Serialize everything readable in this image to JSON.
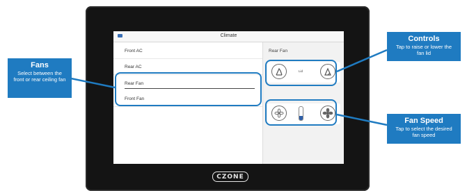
{
  "screen": {
    "title": "Climate",
    "list_items": [
      "Front AC",
      "Rear AC",
      "Rear Fan",
      "Front Fan"
    ],
    "selected_item": "Rear Fan",
    "right_panel_title": "Rear Fan",
    "lid_label": "Lid",
    "fan_speed_level": 0.3
  },
  "brand_logo": "CZONE",
  "callouts": {
    "fans": {
      "title": "Fans",
      "text": "Select between the front or rear ceiling fan"
    },
    "controls": {
      "title": "Controls",
      "text": "Tap to raise or lower the fan lid"
    },
    "fan_speed": {
      "title": "Fan Speed",
      "text": "Tap to select the desired fan speed"
    }
  },
  "colors": {
    "accent": "#1f7bc1",
    "frame": "#141414",
    "slider_fill": "#2f5fa8"
  },
  "icons": [
    "menu-icon",
    "lid-raise-icon",
    "lid-lower-icon",
    "fan-low-icon",
    "fan-high-icon"
  ]
}
